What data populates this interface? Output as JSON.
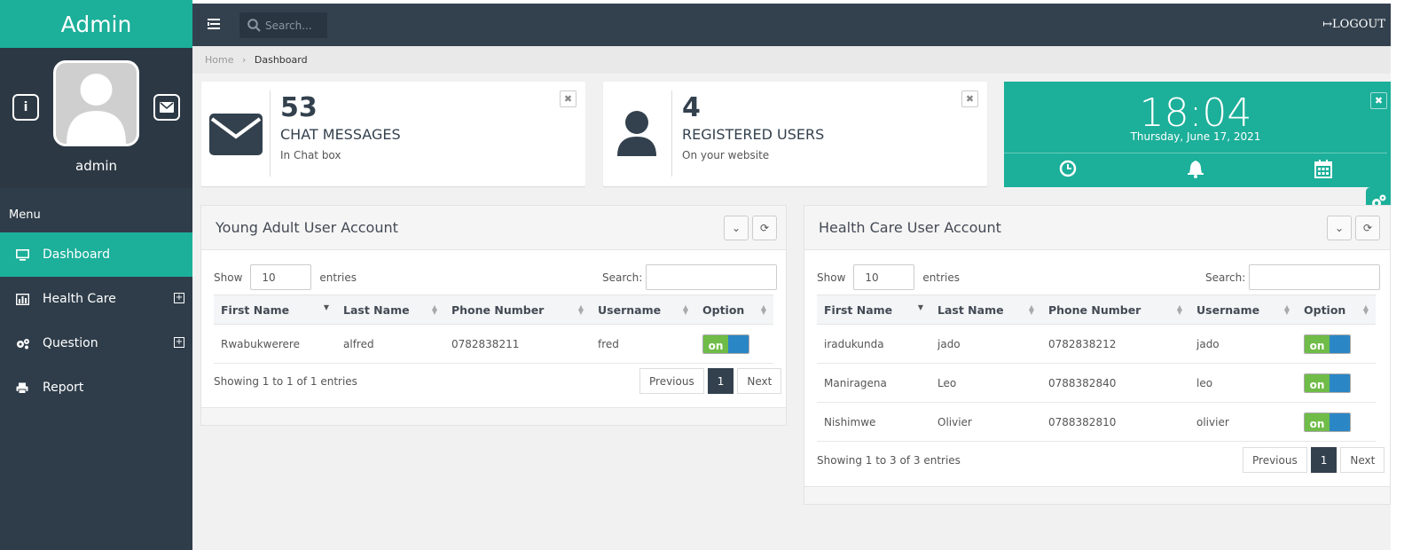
{
  "app": {
    "brand": "Admin"
  },
  "profile": {
    "name": "admin",
    "info_icon": "info-icon",
    "mail_icon": "envelope-icon"
  },
  "menu": {
    "label": "Menu",
    "items": [
      {
        "label": "Dashboard",
        "icon": "monitor-icon",
        "active": true
      },
      {
        "label": "Health Care",
        "icon": "bar-chart-icon",
        "expandable": true
      },
      {
        "label": "Question",
        "icon": "cogs-icon",
        "expandable": true
      },
      {
        "label": "Report",
        "icon": "printer-icon"
      }
    ]
  },
  "topbar": {
    "search_placeholder": "Search...",
    "logout": "LOGOUT"
  },
  "breadcrumb": {
    "home": "Home",
    "current": "Dashboard"
  },
  "widgets": {
    "messages": {
      "count": "53",
      "title": "CHAT MESSAGES",
      "subtitle": "In Chat box"
    },
    "users": {
      "count": "4",
      "title": "REGISTERED USERS",
      "subtitle": "On your website"
    },
    "clock": {
      "time": "18:04",
      "date": "Thursday, June 17, 2021"
    }
  },
  "colors": {
    "accent": "#1caf9a",
    "dark": "#33414e",
    "sidebar": "#2f3d4a",
    "toggle_on": "#6fbc48",
    "toggle_handle": "#2b86c5"
  },
  "young_adult": {
    "title": "Young Adult User Account",
    "show_label": "Show",
    "entries_value": "10",
    "entries_label": "entries",
    "search_label": "Search:",
    "columns": [
      "First Name",
      "Last Name",
      "Phone Number",
      "Username",
      "Option"
    ],
    "rows": [
      {
        "first": "Rwabukwerere",
        "last": "alfred",
        "phone": "0782838211",
        "username": "fred",
        "option": "on"
      }
    ],
    "info": "Showing 1 to 1 of 1 entries",
    "pager": {
      "prev": "Previous",
      "page": "1",
      "next": "Next"
    }
  },
  "health_care": {
    "title": "Health Care User Account",
    "show_label": "Show",
    "entries_value": "10",
    "entries_label": "entries",
    "search_label": "Search:",
    "columns": [
      "First Name",
      "Last Name",
      "Phone Number",
      "Username",
      "Option"
    ],
    "rows": [
      {
        "first": "iradukunda",
        "last": "jado",
        "phone": "0782838212",
        "username": "jado",
        "option": "on"
      },
      {
        "first": "Maniragena",
        "last": "Leo",
        "phone": "0788382840",
        "username": "leo",
        "option": "on"
      },
      {
        "first": "Nishimwe",
        "last": "Olivier",
        "phone": "0788382810",
        "username": "olivier",
        "option": "on"
      }
    ],
    "info": "Showing 1 to 3 of 3 entries",
    "pager": {
      "prev": "Previous",
      "page": "1",
      "next": "Next"
    }
  }
}
